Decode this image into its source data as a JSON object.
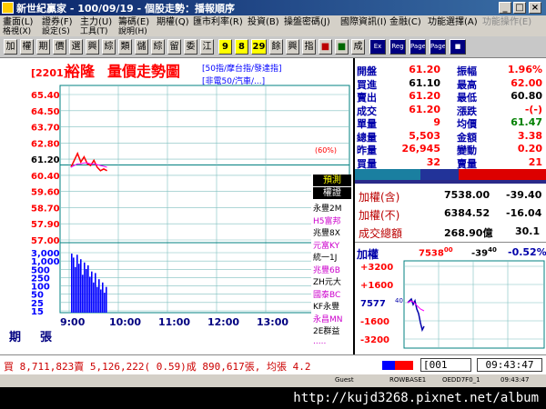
{
  "window": {
    "title": "新世紀贏家 - 100/09/19 - 個股走勢：播報順序"
  },
  "menu": {
    "row1": [
      "畫面(L)",
      "證券(F)",
      "主力(U)",
      "籌碼(E)",
      "期權(Q)",
      "匯市利率(R)",
      "投資(B)",
      "操盤密碼(J)",
      "國際資訊(I)",
      "金融(C)",
      "功能選擇(A)",
      "功能操作(E)"
    ],
    "row2": [
      "格視(X)",
      "設定(S)",
      "工具(T)",
      "說明(H)"
    ]
  },
  "toolbar": {
    "buttons": [
      "加",
      "權",
      "期",
      "價",
      "選",
      "興",
      "綜",
      "類",
      "儲",
      "綜",
      "留",
      "委",
      "江",
      "9",
      "8",
      "29",
      "餘",
      "興",
      "指",
      "■",
      "■",
      "成",
      "Ex",
      "Reg",
      "Page",
      "Page",
      "■"
    ]
  },
  "chart": {
    "code": "[2201]",
    "name": "裕隆",
    "title": "量價走勢圖",
    "tag1": "[50指/摩台指/發達指]",
    "tag2": "[非電50/汽車/...]",
    "price_ticks": [
      "65.40",
      "64.50",
      "63.70",
      "62.80",
      "61.20",
      "60.40",
      "59.60",
      "58.70",
      "57.90",
      "57.00"
    ],
    "volume_ticks": [
      "3,000",
      "1,000",
      "500",
      "250",
      "100",
      "50",
      "25",
      "15"
    ],
    "time_ticks": [
      "9:00",
      "10:00",
      "11:00",
      "12:00",
      "13:00"
    ],
    "ref_label": "(60%)",
    "vol_label_1": "期",
    "vol_label_2": "張"
  },
  "chart_data": {
    "type": "line",
    "ylim": [
      57.0,
      65.4
    ],
    "x": [
      "9:00",
      "9:02",
      "9:04",
      "9:06",
      "9:08",
      "9:10",
      "9:12",
      "9:14",
      "9:16",
      "9:18",
      "9:20",
      "9:22"
    ],
    "series": [
      {
        "values": [
          61.2,
          61.6,
          62.0,
          61.5,
          61.8,
          61.4,
          61.3,
          61.6,
          61.2,
          61.0,
          61.1,
          61.0
        ]
      },
      {
        "values": [
          61.2,
          61.3,
          61.4,
          61.4,
          61.45,
          61.45,
          61.4,
          61.4,
          61.35,
          61.3,
          61.25,
          61.2
        ]
      }
    ],
    "volume": [
      2000,
      1400,
      600,
      1800,
      800,
      1200,
      300,
      900,
      500,
      700,
      250,
      400,
      150,
      350,
      100,
      200,
      80,
      150,
      60,
      100
    ]
  },
  "quote": {
    "rows": [
      {
        "l1": "開盤",
        "v1": "61.20",
        "l2": "振幅",
        "v2": "1.96%",
        "c1": "#ff0000",
        "c2": "#ff0000"
      },
      {
        "l1": "買進",
        "v1": "61.10",
        "l2": "最高",
        "v2": "62.00",
        "c1": "#000000",
        "c2": "#ff0000"
      },
      {
        "l1": "賣出",
        "v1": "61.20",
        "l2": "最低",
        "v2": "60.80",
        "c1": "#ff0000",
        "c2": "#000000"
      },
      {
        "l1": "成交",
        "v1": "61.20",
        "l2": "漲跌",
        "v2": "-(-)",
        "c1": "#ff0000",
        "c2": "#ff0000"
      },
      {
        "l1": "單量",
        "v1": "9",
        "l2": "均價",
        "v2": "61.47",
        "c1": "#ff0000",
        "c2": "#008000"
      },
      {
        "l1": "總量",
        "v1": "5,503",
        "l2": "金額",
        "v2": "3.38",
        "c1": "#ff0000",
        "c2": "#ff0000"
      },
      {
        "l1": "昨量",
        "v1": "26,945",
        "l2": "變動",
        "v2": "0.20",
        "c1": "#ff0000",
        "c2": "#ff0000"
      },
      {
        "l1": "買量",
        "v1": "32",
        "l2": "賣量",
        "v2": "21",
        "c1": "#ff0000",
        "c2": "#ff0000"
      }
    ]
  },
  "predict": {
    "btn1": "預測",
    "btn2": "權證",
    "list": [
      "永豐2M",
      "H5富邦",
      "兆豐8X",
      "元富KY",
      "統一1J",
      "兆豐6B",
      "ZH元大",
      "國泰BC",
      "KF永豐",
      "永昌MN",
      "2E群益",
      "....."
    ]
  },
  "index": {
    "with_label": "加權(含)",
    "with_value": "7538.00",
    "with_change": "-39.40",
    "without_label": "加權(不)",
    "without_value": "6384.52",
    "without_change": "-16.04",
    "amount_label": "成交總額",
    "amount_value": "268.90億",
    "amount_ratio": "30.1"
  },
  "mini": {
    "label": "加權",
    "price": "7538",
    "price_sup": "00",
    "change": "-39",
    "change_sup": "40",
    "pct": "-0.52%",
    "ticks": [
      "+3200",
      "+1600",
      "7577",
      "-1600",
      "-3200"
    ],
    "ref_sub": "40"
  },
  "status": {
    "summary": "買 8,711,823賣 5,126,222( 0.59)成 890,617張, 均張 4.2",
    "code": "[001",
    "time": "09:43:47"
  },
  "bottom": {
    "items": [
      "Guest",
      "ROWBASE1",
      "OEDD7F0_1",
      "09:43:47"
    ]
  },
  "url": {
    "text": "http://kujd3268.pixnet.net/album"
  },
  "colors": {
    "up": "#ff0000",
    "down": "#008000",
    "grid": "#008080",
    "volume": "#0000ff",
    "predict": "#0000ff"
  }
}
